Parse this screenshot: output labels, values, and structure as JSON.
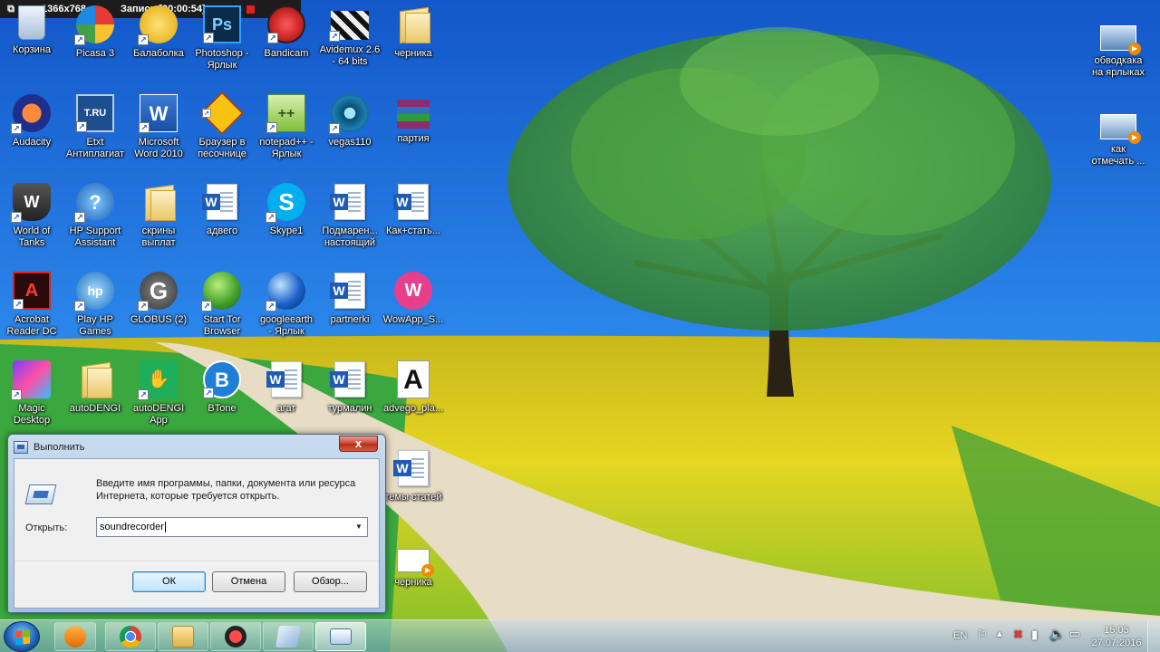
{
  "recorder": {
    "resolution": "1366x768",
    "recording": "Запись [00:00:54]"
  },
  "desktop_icons": [
    {
      "label": "Корзина"
    },
    {
      "label": "Picasa 3"
    },
    {
      "label": "Балаболка"
    },
    {
      "label": "Photoshop -\nЯрлык"
    },
    {
      "label": "Bandicam"
    },
    {
      "label": "Avidemux 2.6\n- 64 bits"
    },
    {
      "label": "черника"
    },
    {
      "label": "Audacity"
    },
    {
      "label": "Etxt\nАнтиплагиат"
    },
    {
      "label": "Microsoft\nWord 2010"
    },
    {
      "label": "Браузер в\nпесочнице"
    },
    {
      "label": "notepad++ -\nЯрлык"
    },
    {
      "label": "vegas110"
    },
    {
      "label": "партия"
    },
    {
      "label": "World of\nTanks"
    },
    {
      "label": "HP Support\nAssistant"
    },
    {
      "label": "скрины\nвыплат"
    },
    {
      "label": "адвего"
    },
    {
      "label": "Skype1"
    },
    {
      "label": "Подмарен...\nнастоящий"
    },
    {
      "label": "Как+стать..."
    },
    {
      "label": "Acrobat\nReader DC"
    },
    {
      "label": "Play HP\nGames"
    },
    {
      "label": "GLOBUS (2)"
    },
    {
      "label": "Start Tor\nBrowser"
    },
    {
      "label": "googleearth\n- Ярлык"
    },
    {
      "label": "partnerki"
    },
    {
      "label": "WowApp_S..."
    },
    {
      "label": "Magic\nDesktop"
    },
    {
      "label": "autoDENGI"
    },
    {
      "label": "autoDENGI\nApp"
    },
    {
      "label": "BTone"
    },
    {
      "label": "агат"
    },
    {
      "label": "турмалин"
    },
    {
      "label": "advego_pla..."
    },
    {
      "label": "темы статей"
    },
    {
      "label": "черника"
    },
    {
      "label": "обводкака\nна ярлыках"
    },
    {
      "label": "как\nотмечать ..."
    }
  ],
  "run_dialog": {
    "title": "Выполнить",
    "close": "x",
    "description": "Введите имя программы, папки, документа или ресурса\nИнтернета, которые требуется открыть.",
    "open_label": "Открыть:",
    "open_value": "soundrecorder",
    "ok": "ОК",
    "cancel": "Отмена",
    "browse": "Обзор..."
  },
  "tray": {
    "language": "EN",
    "time": "15:05",
    "date": "27.07.2016"
  },
  "colors": {
    "sky": "#1e6fd9",
    "field": "#e8d820",
    "grass": "#2ea13a"
  }
}
